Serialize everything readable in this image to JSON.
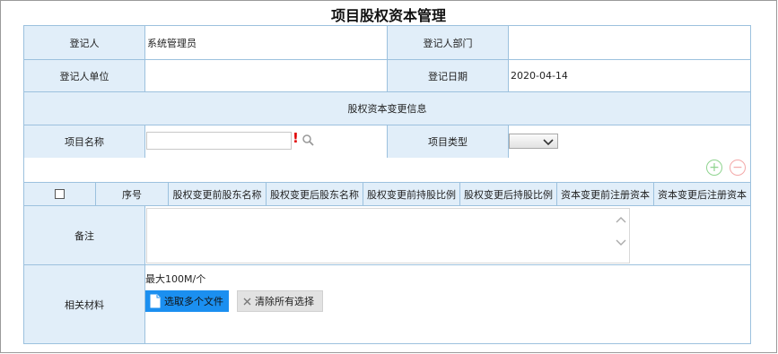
{
  "page_title": "项目股权资本管理",
  "form": {
    "registrant_label": "登记人",
    "registrant_value": "系统管理员",
    "registrant_dept_label": "登记人部门",
    "registrant_dept_value": "",
    "registrant_unit_label": "登记人单位",
    "registrant_unit_value": "",
    "register_date_label": "登记日期",
    "register_date_value": "2020-04-14",
    "section_label": "股权资本变更信息",
    "project_name_label": "项目名称",
    "project_name_value": "",
    "required_mark": "!",
    "project_type_label": "项目类型",
    "project_type_value": "",
    "remarks_label": "备注",
    "remarks_value": "",
    "materials_label": "相关材料"
  },
  "table": {
    "columns": [
      "序号",
      "股权变更前股东名称",
      "股权变更后股东名称",
      "股权变更前持股比例",
      "股权变更后持股比例",
      "资本变更前注册资本",
      "资本变更后注册资本"
    ]
  },
  "toolbar": {
    "add_symbol": "+",
    "remove_symbol": "−"
  },
  "upload": {
    "limit_text": "最大100M/个",
    "select_files_label": "选取多个文件",
    "clear_label": "清除所有选择"
  },
  "colors": {
    "header_bg": "#e1eef9",
    "border": "#9cc1de",
    "required": "#e00000",
    "upload_button": "#1b8ff0",
    "add_button": "#8fd48f",
    "remove_button": "#f3a8a8"
  },
  "icons": [
    "search-icon",
    "select-arrow-icon",
    "add-row-icon",
    "remove-row-icon",
    "file-icon",
    "close-icon",
    "scroll-up-icon",
    "scroll-down-icon"
  ]
}
